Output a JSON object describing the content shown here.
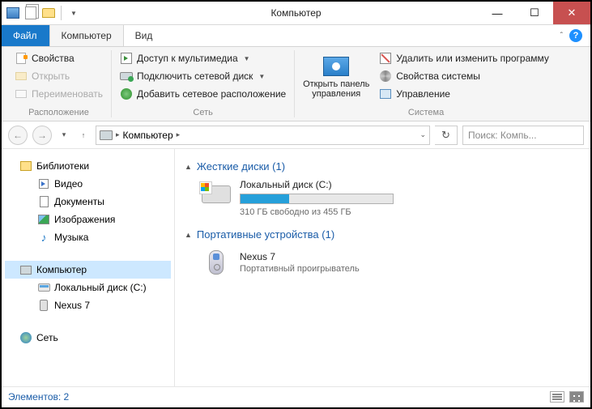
{
  "window": {
    "title": "Компьютер"
  },
  "tabs": {
    "file": "Файл",
    "computer": "Компьютер",
    "view": "Вид"
  },
  "ribbon": {
    "groups": {
      "location": {
        "label": "Расположение",
        "properties": "Свойства",
        "open": "Открыть",
        "rename": "Переименовать"
      },
      "network": {
        "label": "Сеть",
        "media_access": "Доступ к мультимедиа",
        "map_drive": "Подключить сетевой диск",
        "add_location": "Добавить сетевое расположение"
      },
      "system": {
        "label": "Система",
        "control_panel_l1": "Открыть панель",
        "control_panel_l2": "управления",
        "uninstall": "Удалить или изменить программу",
        "sys_props": "Свойства системы",
        "manage": "Управление"
      }
    }
  },
  "nav": {
    "crumb": "Компьютер",
    "search_placeholder": "Поиск: Компь..."
  },
  "tree": {
    "libraries": "Библиотеки",
    "videos": "Видео",
    "documents": "Документы",
    "pictures": "Изображения",
    "music": "Музыка",
    "computer": "Компьютер",
    "local_disk": "Локальный диск (C:)",
    "nexus": "Nexus 7",
    "network": "Сеть"
  },
  "content": {
    "hdd_section": "Жесткие диски (1)",
    "drive": {
      "name": "Локальный диск (C:)",
      "free_text": "310 ГБ свободно из 455 ГБ",
      "used_pct": 32
    },
    "portable_section": "Портативные устройства (1)",
    "device": {
      "name": "Nexus 7",
      "type": "Портативный проигрыватель"
    }
  },
  "status": {
    "items": "Элементов: 2"
  }
}
